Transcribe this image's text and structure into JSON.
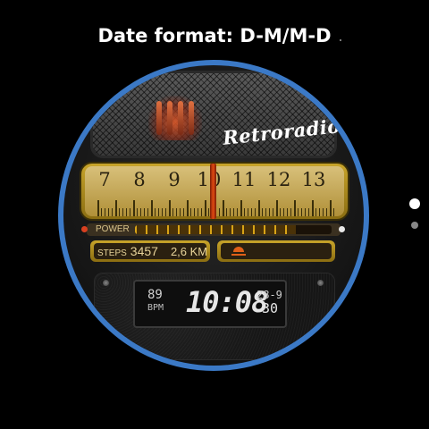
{
  "header": {
    "title": "Date format: D-M/M-D"
  },
  "watch": {
    "brand": "Retroradio",
    "dial_numbers": [
      "7",
      "8",
      "9",
      "10",
      "11",
      "12",
      "13"
    ],
    "power_label": "POWER",
    "power_level": 0.82,
    "steps_label": "STEPS",
    "steps_value": "3457",
    "distance": "2,6 KM",
    "heart_rate": "89",
    "heart_unit": "BPM",
    "time": "10:08",
    "date_line1": "28-9",
    "date_line2": "30",
    "colors": {
      "bezel": "#3b79c6",
      "needle": "#e24a12",
      "gold": "#c8a42a"
    }
  },
  "pager": {
    "total": 2,
    "active": 0
  }
}
